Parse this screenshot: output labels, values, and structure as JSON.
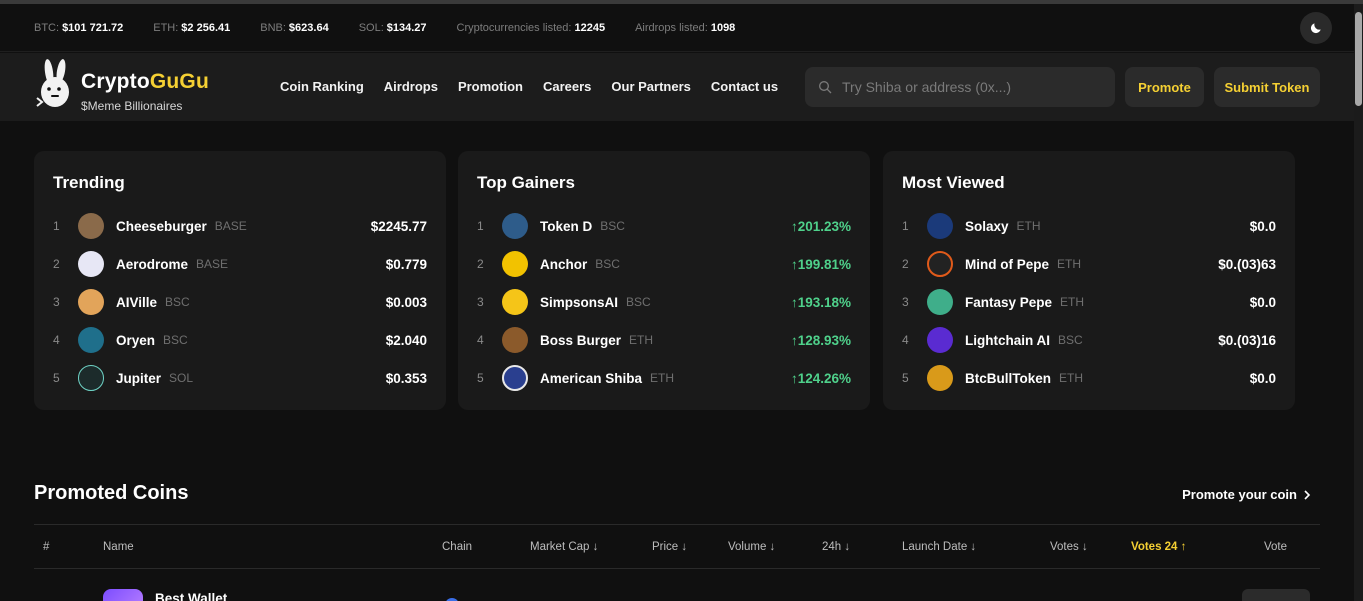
{
  "ticker": {
    "items": [
      {
        "label": "BTC:",
        "value": "$101 721.72"
      },
      {
        "label": "ETH:",
        "value": "$2 256.41"
      },
      {
        "label": "BNB:",
        "value": "$623.64"
      },
      {
        "label": "SOL:",
        "value": "$134.27"
      },
      {
        "label": "Cryptocurrencies listed:",
        "value": "12245"
      },
      {
        "label": "Airdrops listed:",
        "value": "1098"
      }
    ],
    "theme_icon": "moon-icon"
  },
  "header": {
    "brand_part1": "Crypto",
    "brand_part2": "GuGu",
    "tagline": "$Meme Billionaires",
    "nav": [
      "Coin Ranking",
      "Airdrops",
      "Promotion",
      "Careers",
      "Our Partners",
      "Contact us"
    ],
    "search_placeholder": "Try Shiba or address (0x...)",
    "promote_label": "Promote",
    "submit_label": "Submit Token"
  },
  "trending": {
    "title": "Trending",
    "rows": [
      {
        "rank": "1",
        "name": "Cheeseburger",
        "chain": "BASE",
        "price": "$2245.77",
        "color": "#8a6a4a"
      },
      {
        "rank": "2",
        "name": "Aerodrome",
        "chain": "BASE",
        "price": "$0.779",
        "color": "#e7e7f5"
      },
      {
        "rank": "3",
        "name": "AIVille",
        "chain": "BSC",
        "price": "$0.003",
        "color": "#e2a45a"
      },
      {
        "rank": "4",
        "name": "Oryen",
        "chain": "BSC",
        "price": "$2.040",
        "color": "#1f6f8b"
      },
      {
        "rank": "5",
        "name": "Jupiter",
        "chain": "SOL",
        "price": "$0.353",
        "color": "#1c2b2b"
      }
    ]
  },
  "gainers": {
    "title": "Top Gainers",
    "rows": [
      {
        "rank": "1",
        "name": "Token D",
        "chain": "BSC",
        "change": "↑201.23%",
        "color": "#2e5c8a"
      },
      {
        "rank": "2",
        "name": "Anchor",
        "chain": "BSC",
        "change": "↑199.81%",
        "color": "#f2c200"
      },
      {
        "rank": "3",
        "name": "SimpsonsAI",
        "chain": "BSC",
        "change": "↑193.18%",
        "color": "#f5c518"
      },
      {
        "rank": "4",
        "name": "Boss Burger",
        "chain": "ETH",
        "change": "↑128.93%",
        "color": "#8b5a2b"
      },
      {
        "rank": "5",
        "name": "American Shiba",
        "chain": "ETH",
        "change": "↑124.26%",
        "color": "#2a3f8f"
      }
    ]
  },
  "viewed": {
    "title": "Most Viewed",
    "rows": [
      {
        "rank": "1",
        "name": "Solaxy",
        "chain": "ETH",
        "price": "$0.0",
        "color": "#1b3a7a"
      },
      {
        "rank": "2",
        "name": "Mind of Pepe",
        "chain": "ETH",
        "price": "$0.(03)63",
        "color": "#222222"
      },
      {
        "rank": "3",
        "name": "Fantasy Pepe",
        "chain": "ETH",
        "price": "$0.0",
        "color": "#3fae8a"
      },
      {
        "rank": "4",
        "name": "Lightchain AI",
        "chain": "BSC",
        "price": "$0.(03)16",
        "color": "#5a2bd1"
      },
      {
        "rank": "5",
        "name": "BtcBullToken",
        "chain": "ETH",
        "price": "$0.0",
        "color": "#d99a1a"
      }
    ]
  },
  "promoted": {
    "title": "Promoted Coins",
    "link": "Promote your coin",
    "columns": {
      "num": "#",
      "name": "Name",
      "chain": "Chain",
      "mcap": "Market Cap ↓",
      "price": "Price ↓",
      "volume": "Volume ↓",
      "h24": "24h ↓",
      "launch": "Launch Date ↓",
      "votes": "Votes ↓",
      "votes24": "Votes 24 ↑",
      "vote": "Vote"
    },
    "first_row_name": "Best Wallet"
  }
}
